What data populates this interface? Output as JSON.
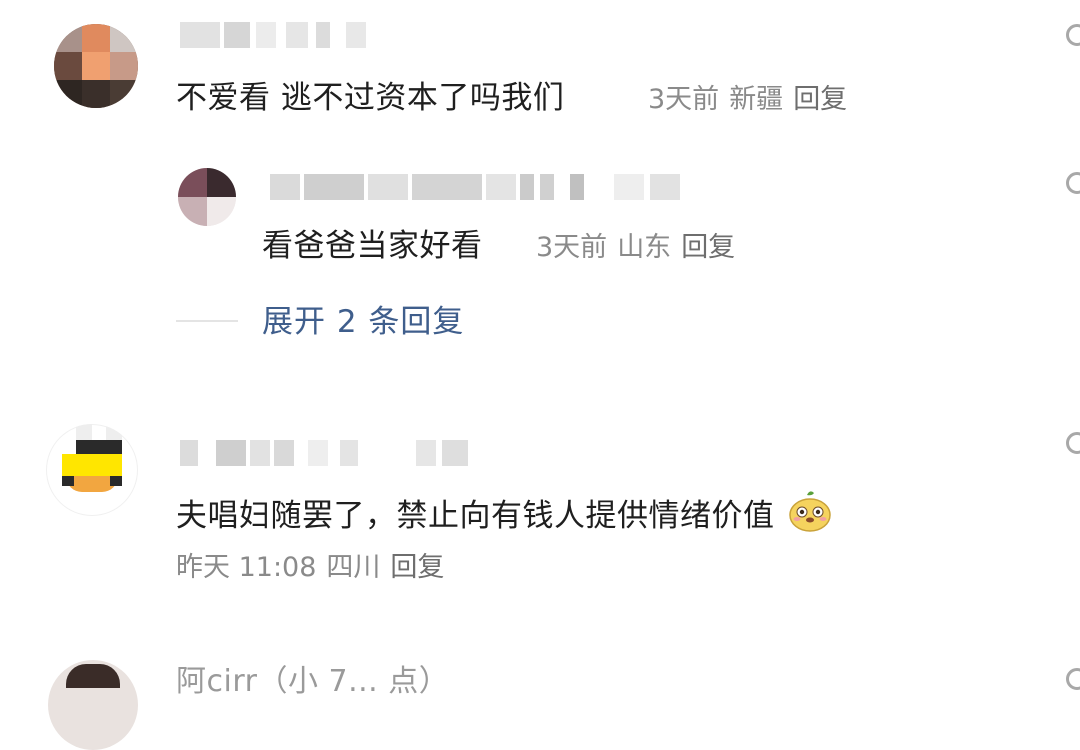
{
  "comments": [
    {
      "text": "不爱看 逃不过资本了吗我们",
      "time": "3天前",
      "location": "新疆",
      "reply_label": "回复",
      "replies": [
        {
          "text": "看爸爸当家好看",
          "time": "3天前",
          "location": "山东",
          "reply_label": "回复"
        }
      ],
      "expand_label": "展开 2 条回复"
    },
    {
      "text": "夫唱妇随罢了，禁止向有钱人提供情绪价值",
      "emoji": "cute-face-emoji",
      "time": "昨天 11:08",
      "location": "四川",
      "reply_label": "回复"
    },
    {
      "partial_name": "阿cirr（小 7... 点）"
    }
  ],
  "colors": {
    "text": "#1f1f1f",
    "meta": "#8a8a8a",
    "link": "#3f5e8c",
    "background": "#ffffff"
  }
}
